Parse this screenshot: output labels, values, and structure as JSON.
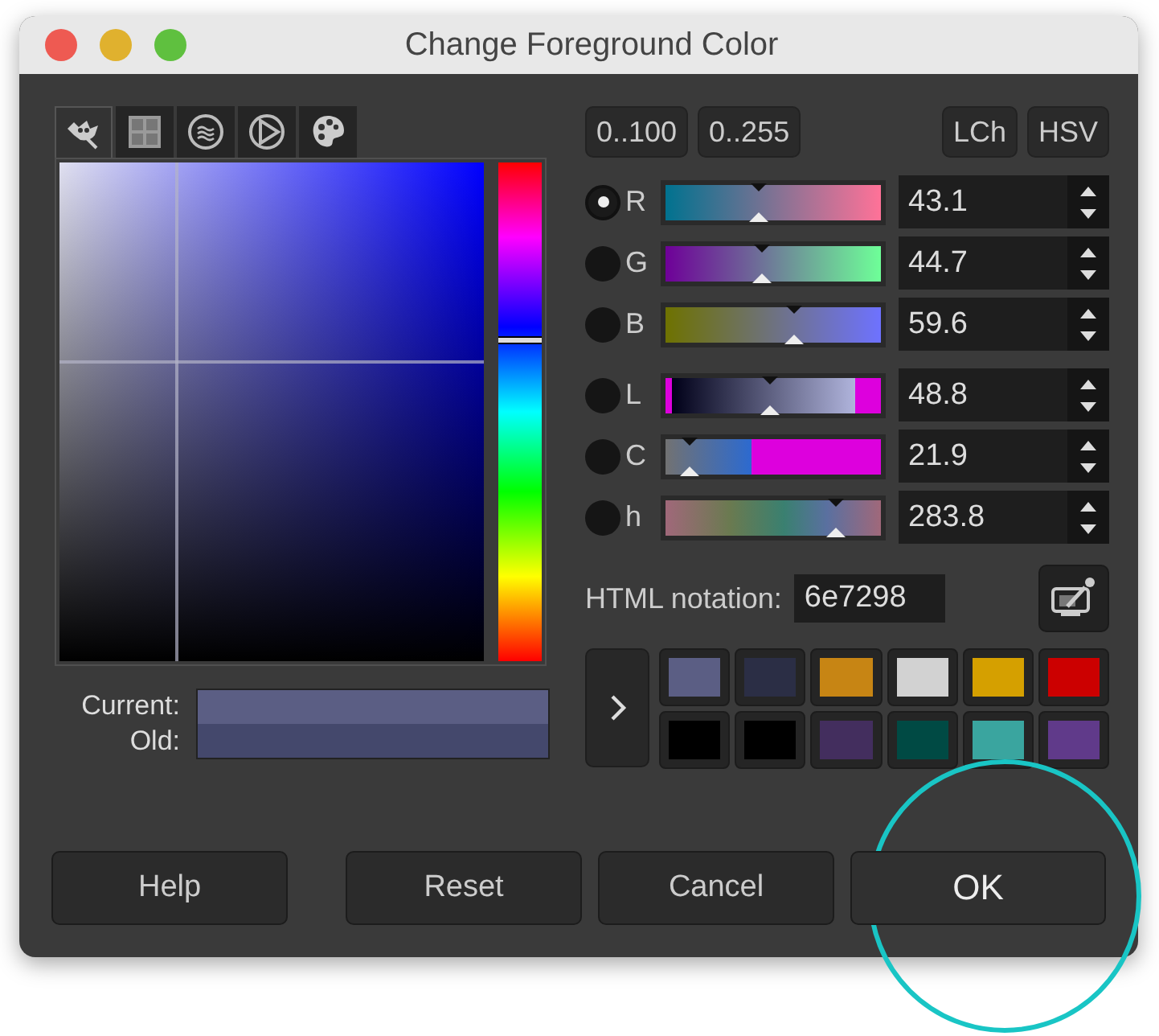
{
  "window": {
    "title": "Change Foreground Color"
  },
  "selector_tabs": [
    {
      "kind": "wilber",
      "selected": true
    },
    {
      "kind": "cmyk",
      "selected": false
    },
    {
      "kind": "water",
      "selected": false
    },
    {
      "kind": "triangle",
      "selected": false
    },
    {
      "kind": "palette",
      "selected": false
    }
  ],
  "range_buttons": [
    {
      "label": "0..100",
      "selected": false
    },
    {
      "label": "0..255",
      "selected": false
    }
  ],
  "model_buttons": [
    {
      "label": "LCh",
      "selected": false
    },
    {
      "label": "HSV",
      "selected": false
    }
  ],
  "channels": [
    {
      "kind": "r",
      "name": "R",
      "selected": true,
      "level": 0.431,
      "value": "43.1"
    },
    {
      "kind": "g",
      "name": "G",
      "selected": false,
      "level": 0.447,
      "value": "44.7"
    },
    {
      "kind": "b",
      "name": "B",
      "selected": false,
      "level": 0.596,
      "value": "59.6"
    },
    {
      "kind": "l",
      "name": "L",
      "selected": false,
      "level": 0.488,
      "value": "48.8"
    },
    {
      "kind": "c",
      "name": "C",
      "selected": false,
      "level": 0.11,
      "value": "21.9"
    },
    {
      "kind": "h",
      "name": "h",
      "selected": false,
      "level": 0.788,
      "value": "283.8"
    }
  ],
  "html_notation": {
    "label": "HTML notation:",
    "value": "6e7298"
  },
  "comparison": [
    {
      "label": "Current:",
      "color": "#5b5e84"
    },
    {
      "label": "Old:",
      "color": "#44486c"
    }
  ],
  "history": [
    {
      "color": "#5b5e84"
    },
    {
      "color": "#2b2e45"
    },
    {
      "color": "#c78514"
    },
    {
      "color": "#d2d2d2"
    },
    {
      "color": "#d5a000"
    },
    {
      "color": "#cc0000"
    },
    {
      "color": "#000000"
    },
    {
      "color": "#000000"
    },
    {
      "color": "#432e5e"
    },
    {
      "color": "#004a44"
    },
    {
      "color": "#3aa59f"
    },
    {
      "color": "#603a8a"
    }
  ],
  "buttons": [
    {
      "label": "Help"
    },
    {
      "label": "Reset"
    },
    {
      "label": "Cancel"
    },
    {
      "label": "OK"
    }
  ]
}
